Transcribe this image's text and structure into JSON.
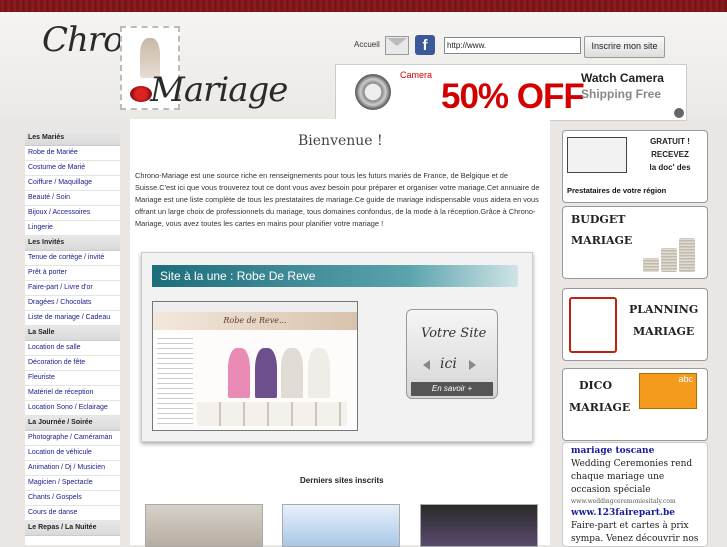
{
  "header": {
    "logo_line1": "Chrono",
    "logo_line2": "Mariage",
    "accueil": "Accueil",
    "url_value": "http://www.",
    "inscrire_label": "Inscrire mon site",
    "fb_letter": "f"
  },
  "banner": {
    "camera": "Camera",
    "discount": "50% OFF",
    "line1": "Watch Camera",
    "line2": "Shipping Free"
  },
  "sidebar": [
    {
      "type": "cat",
      "label": "Les Mariés"
    },
    {
      "type": "item",
      "label": "Robe de Mariée"
    },
    {
      "type": "item",
      "label": "Costume de Marié"
    },
    {
      "type": "item",
      "label": "Coiffure / Maquillage"
    },
    {
      "type": "item",
      "label": "Beauté / Soin"
    },
    {
      "type": "item",
      "label": "Bijoux / Accessoires"
    },
    {
      "type": "item",
      "label": "Lingerie"
    },
    {
      "type": "cat",
      "label": "Les Invités"
    },
    {
      "type": "item",
      "label": "Tenue de cortège / invité"
    },
    {
      "type": "item",
      "label": "Prêt à porter"
    },
    {
      "type": "item",
      "label": "Faire-part / Livre d'or"
    },
    {
      "type": "item",
      "label": "Dragées / Chocolats"
    },
    {
      "type": "item",
      "label": "Liste de mariage / Cadeau"
    },
    {
      "type": "cat",
      "label": "La Salle"
    },
    {
      "type": "item",
      "label": "Location de salle"
    },
    {
      "type": "item",
      "label": "Décoration de fête"
    },
    {
      "type": "item",
      "label": "Fleuriste"
    },
    {
      "type": "item",
      "label": "Matériel de réception"
    },
    {
      "type": "item",
      "label": "Location Sono / Eclairage"
    },
    {
      "type": "cat",
      "label": "La Journée / Soirée"
    },
    {
      "type": "item",
      "label": "Photographe / Caméraman"
    },
    {
      "type": "item",
      "label": "Location de véhicule"
    },
    {
      "type": "item",
      "label": "Animation / Dj / Musicien"
    },
    {
      "type": "item",
      "label": "Magicien / Spectacle"
    },
    {
      "type": "item",
      "label": "Chants / Gospels"
    },
    {
      "type": "item",
      "label": "Cours de danse"
    },
    {
      "type": "cat",
      "label": "Le Repas / La Nuitée"
    }
  ],
  "main": {
    "title": "Bienvenue !",
    "intro": "Chrono-Mariage est une source riche en renseignements pour tous les futurs mariés de France, de Belgique et de Suisse.C'est ici que vous trouverez tout ce dont vous avez besoin pour préparer et organiser votre mariage.Cet annuaire de Mariage est une liste complète de tous les prestataires de mariage.Ce guide de mariage indispensable vous aidera en vous offrant un large choix de professionnels du mariage, tous domaines confondus, de la mode à la réception.Grâce à Chrono-Mariage, vous avez toutes les cartes en mains pour planifier votre mariage !",
    "featured_title": "Site à la une : Robe De Reve",
    "featured_shot_title": "Robe de Reve...",
    "votre_site_l1": "Votre Site",
    "votre_site_l2": "ici",
    "en_savoir": "En savoir +",
    "derniers": "Derniers sites inscrits"
  },
  "right": {
    "gratuit": [
      "GRATUIT !",
      "RECEVEZ",
      "la doc' des"
    ],
    "gratuit_bottom": "Prestataires de votre région",
    "budget": [
      "BUDGET",
      "MARIAGE"
    ],
    "planning": [
      "PLANNING",
      "MARIAGE"
    ],
    "dico": [
      "DICO",
      "MARIAGE"
    ],
    "dico_badge": "abc",
    "ads": [
      {
        "title": "mariage toscane",
        "text": "Wedding Ceremonies rend chaque mariage une occasion spéciale",
        "url": "www.weddingceremoniesitaly.com"
      },
      {
        "title": "www.123fairepart.be",
        "text": "Faire-part et cartes à prix sympa. Venez découvrir nos",
        "url": ""
      }
    ]
  },
  "colors": {
    "topbar": "#7a1518",
    "link": "#1a1a8a",
    "featured_bar": "#1d6d7a",
    "ad_title": "#1a1aa0",
    "promo_red": "#d40000"
  }
}
